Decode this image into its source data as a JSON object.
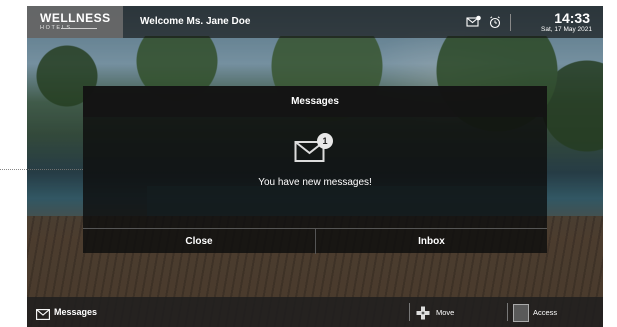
{
  "brand": {
    "name": "WELLNESS",
    "sub": "HOTELS"
  },
  "header": {
    "welcome": "Welcome Ms. Jane Doe",
    "time": "14:33",
    "date": "Sat, 17 May 2021",
    "icons": [
      "mail-notification-icon",
      "alarm-clock-icon"
    ]
  },
  "modal": {
    "title": "Messages",
    "badge_count": "1",
    "message": "You have new messages!",
    "buttons": {
      "close": "Close",
      "inbox": "Inbox"
    }
  },
  "footer": {
    "messages_label": "Messages",
    "move_label": "Move",
    "access_label": "Access"
  },
  "colors": {
    "overlay": "#141414",
    "text": "#ffffff",
    "badge": "#e8e8e8"
  }
}
